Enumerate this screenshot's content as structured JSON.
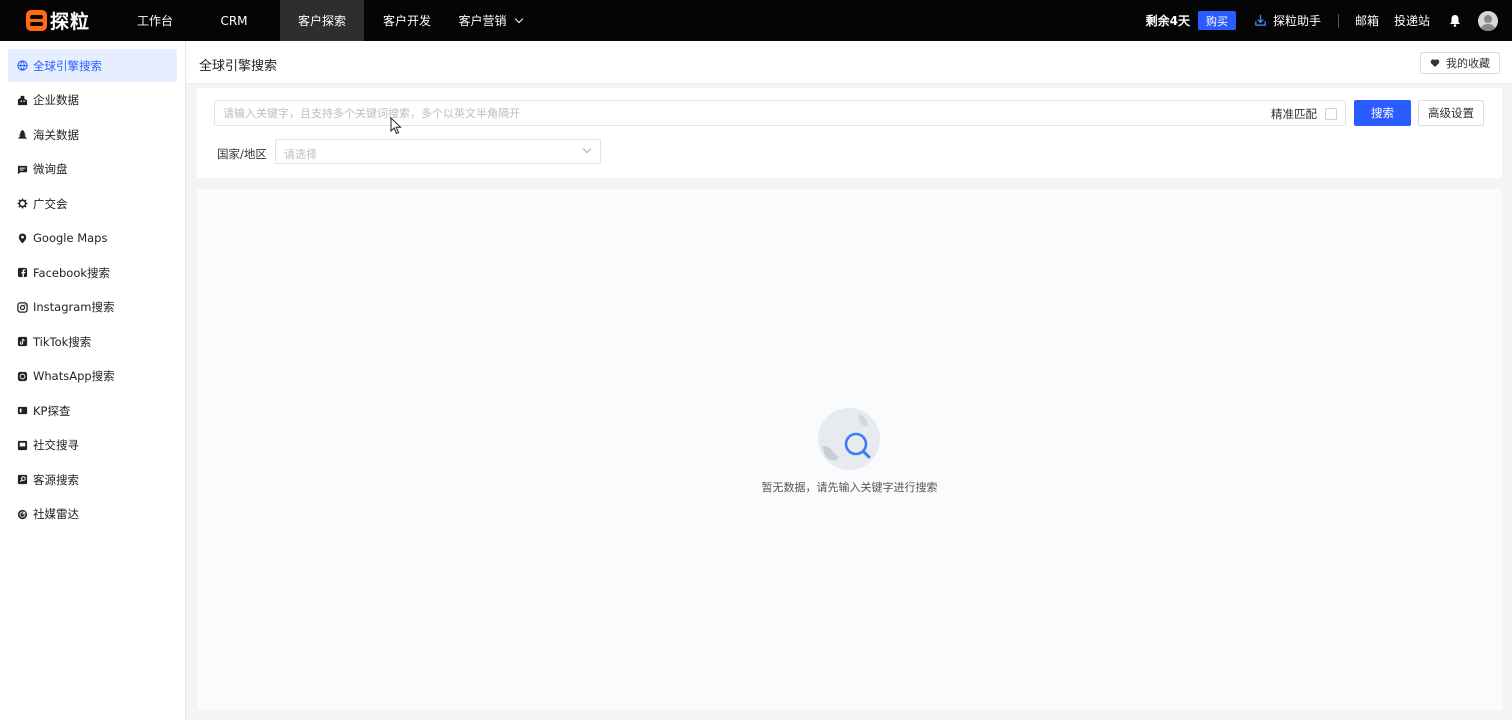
{
  "app": {
    "logo_text": "探粒"
  },
  "nav": {
    "items": [
      {
        "label": "工作台"
      },
      {
        "label": "CRM"
      },
      {
        "label": "客户探索"
      },
      {
        "label": "客户开发"
      },
      {
        "label": "客户营销"
      }
    ],
    "active_index": 2
  },
  "top_right": {
    "remaining": "剩余4天",
    "buy": "购买",
    "assistant": "探粒助手",
    "mail": "邮箱",
    "delivery": "投递站"
  },
  "sidebar": {
    "items": [
      {
        "label": "全球引擎搜索",
        "icon": "globe-icon"
      },
      {
        "label": "企业数据",
        "icon": "building-icon"
      },
      {
        "label": "海关数据",
        "icon": "customs-icon"
      },
      {
        "label": "微询盘",
        "icon": "message-icon"
      },
      {
        "label": "广交会",
        "icon": "fair-icon"
      },
      {
        "label": "Google Maps",
        "icon": "map-pin-icon"
      },
      {
        "label": "Facebook搜索",
        "icon": "facebook-icon"
      },
      {
        "label": "Instagram搜索",
        "icon": "instagram-icon"
      },
      {
        "label": "TikTok搜索",
        "icon": "tiktok-icon"
      },
      {
        "label": "WhatsApp搜索",
        "icon": "whatsapp-icon"
      },
      {
        "label": "KP探查",
        "icon": "kp-icon"
      },
      {
        "label": "社交搜寻",
        "icon": "social-icon"
      },
      {
        "label": "客源搜索",
        "icon": "source-icon"
      },
      {
        "label": "社媒雷达",
        "icon": "radar-icon"
      }
    ],
    "active_index": 0
  },
  "page": {
    "title": "全球引擎搜索",
    "favorites": "我的收藏"
  },
  "search": {
    "placeholder": "请输入关键字，且支持多个关键词搜索，多个以英文半角隔开",
    "value": "",
    "exact_match_label": "精准匹配",
    "exact_match_checked": false,
    "search_button": "搜索",
    "advanced_button": "高级设置",
    "country_label": "国家/地区",
    "country_placeholder": "请选择"
  },
  "empty_state": {
    "text": "暂无数据，请先输入关键字进行搜索"
  },
  "colors": {
    "accent": "#2a5cff",
    "topbar": "#050505",
    "logo": "#ff6a13"
  }
}
